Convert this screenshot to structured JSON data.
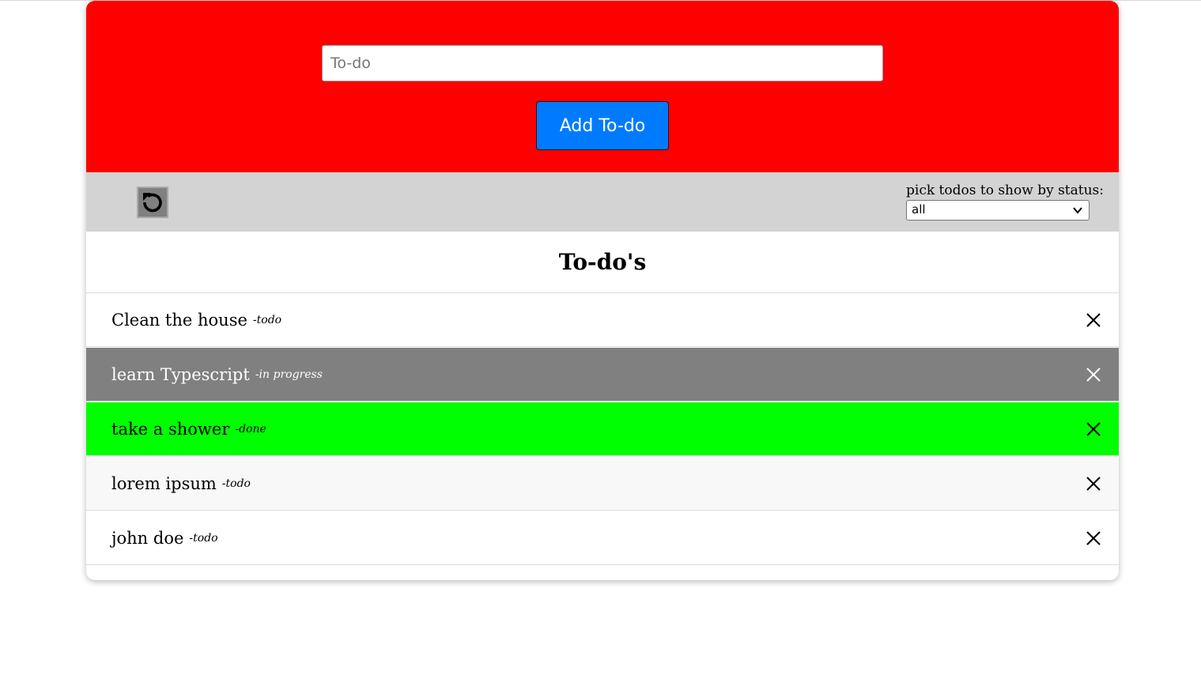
{
  "header": {
    "input": {
      "placeholder": "To-do",
      "value": ""
    },
    "add_button_label": "Add To-do",
    "background_color": "#ff0000",
    "button_color": "#007bff"
  },
  "toolbar": {
    "reset_icon": "reset-icon",
    "filter_label": "pick todos to show by status:",
    "filter_selected": "all"
  },
  "list": {
    "title": "To-do's",
    "items": [
      {
        "text": "Clean the house",
        "status": "-todo",
        "bg": "#ffffff",
        "color": "#000000"
      },
      {
        "text": "learn Typescript",
        "status": "-in progress",
        "bg": "#808080",
        "color": "#ffffff"
      },
      {
        "text": "take a shower",
        "status": "-done",
        "bg": "#00ff00",
        "color": "#000000"
      },
      {
        "text": "lorem ipsum",
        "status": "-todo",
        "bg": "#f8f8f8",
        "color": "#000000"
      },
      {
        "text": "john doe",
        "status": "-todo",
        "bg": "#ffffff",
        "color": "#000000"
      }
    ]
  }
}
